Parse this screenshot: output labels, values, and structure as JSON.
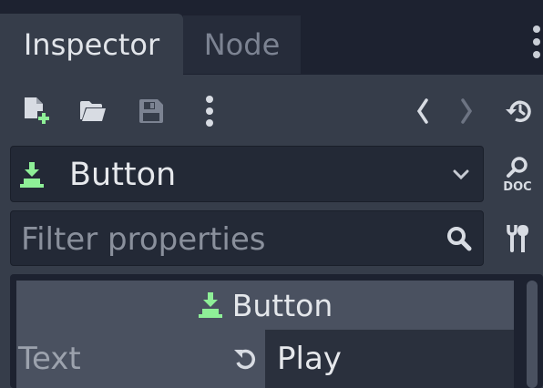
{
  "tabs": {
    "inspector": "Inspector",
    "node": "Node"
  },
  "toolbar": {
    "new_resource_icon": "new-resource-icon",
    "open_icon": "folder-open-icon",
    "save_icon": "save-icon",
    "more_icon": "vertical-dots-icon",
    "back_icon": "chevron-left-icon",
    "forward_icon": "chevron-right-icon",
    "history_icon": "history-icon"
  },
  "object": {
    "name": "Button",
    "docs_icon": "docs-icon"
  },
  "filter": {
    "placeholder": "Filter properties"
  },
  "section": {
    "title": "Button"
  },
  "property": {
    "label": "Text",
    "value": "Play"
  },
  "colors": {
    "accent_green": "#8eef97",
    "panel": "#363d4a",
    "field": "#232936"
  }
}
